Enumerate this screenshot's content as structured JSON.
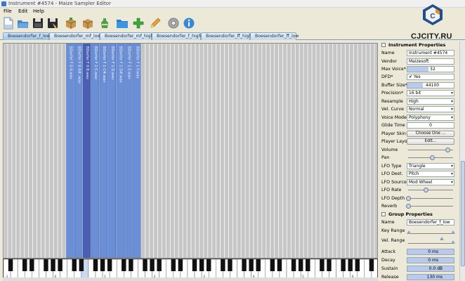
{
  "window": {
    "title": "Instrument #4574 - Maize Sampler Editor"
  },
  "watermark": {
    "text": "CJCITY.RU"
  },
  "menu": [
    {
      "label": "File"
    },
    {
      "label": "Edit"
    },
    {
      "label": "Help"
    }
  ],
  "toolbar": {
    "buttons": [
      {
        "icon": "new-file-icon"
      },
      {
        "icon": "open-folder-icon"
      },
      {
        "icon": "save-icon"
      },
      {
        "icon": "save-as-icon"
      },
      {
        "icon": "package-icon"
      },
      {
        "icon": "open-package-icon"
      },
      {
        "icon": "bottle-icon"
      },
      {
        "icon": "folder-icon"
      },
      {
        "icon": "add-icon"
      },
      {
        "icon": "pencil-icon"
      },
      {
        "icon": "settings-icon"
      },
      {
        "icon": "info-icon"
      }
    ]
  },
  "tabs": [
    {
      "label": "Boesendorfer_f_low",
      "active": true
    },
    {
      "label": "Boesendorfer_mf_low"
    },
    {
      "label": "Boesendorfer_mf_high"
    },
    {
      "label": "Boesendorfer_f_high"
    },
    {
      "label": "Boesendorfer_ff_high"
    },
    {
      "label": "Boesendorfer_ff_low"
    }
  ],
  "samples": [
    {
      "label": "BDorfer F 0 A.wav"
    },
    {
      "label": "BDorfer F 0 A# .wav"
    },
    {
      "label": "BDorfer F 0 B.wav"
    },
    {
      "label": "BDorfer F 1 C.wav"
    },
    {
      "label": "BDorfer F 1 C#.wav"
    },
    {
      "label": "BDorfer F 1 D.wav"
    },
    {
      "label": "BDorfer F 1 D#.wav"
    },
    {
      "label": "BDorfer F 1 E.wav"
    },
    {
      "label": "BDorfer F 1 F.wav"
    }
  ],
  "keyboard": {
    "octave_labels": [
      "-1",
      "0",
      "1",
      "2",
      "3",
      "4",
      "5",
      "6",
      "7",
      "8"
    ]
  },
  "instrument_properties": {
    "header": "Instrument Properties",
    "name_label": "Name",
    "name_value": "Instrument #4574",
    "vendor_label": "Vendor",
    "vendor_value": "Maizesoft",
    "max_voice_label": "Max Voice*",
    "max_voice_value": "32",
    "dfd_label": "DFD*",
    "dfd_value": "Yes",
    "buffer_label": "Buffer Size*",
    "buffer_value": "44100",
    "precision_label": "Precision*",
    "precision_value": "16 bit",
    "resample_label": "Resample",
    "resample_value": "High",
    "vel_curve_label": "Vel. Curve",
    "vel_curve_value": "Normal",
    "voice_mode_label": "Voice Mode",
    "voice_mode_value": "Polyphony",
    "glide_label": "Glide Time",
    "glide_value": "0",
    "player_skin_label": "Player Skin",
    "player_skin_button": "Choose One ...",
    "player_layout_label": "Player Layout",
    "player_layout_button": "Edit...",
    "volume_label": "Volume",
    "volume_level": 0.9,
    "pan_label": "Pan",
    "pan_level": 0.55,
    "lfo_type_label": "LFO Type",
    "lfo_type_value": "Triangle",
    "lfo_dest_label": "LFO Dest.",
    "lfo_dest_value": "Pitch",
    "lfo_source_label": "LFO Source",
    "lfo_source_value": "Mod Wheel",
    "lfo_rate_label": "LFO Rate",
    "lfo_rate_level": 0.4,
    "lfo_depth_label": "LFO Depth",
    "lfo_depth_level": 0.0,
    "reverb_label": "Reverb",
    "reverb_level": 0.0
  },
  "group_properties": {
    "header": "Group Properties",
    "name_label": "Name",
    "name_value": "Boesendorfer_f_low",
    "key_range_label": "Key Range",
    "vel_range_label": "Vel. Range",
    "attack_label": "Attack",
    "attack_value": "0 ms",
    "decay_label": "Decay",
    "decay_value": "0 ms",
    "sustain_label": "Sustain",
    "sustain_value": "0.0 dB",
    "release_label": "Release",
    "release_value": "130 ms"
  }
}
